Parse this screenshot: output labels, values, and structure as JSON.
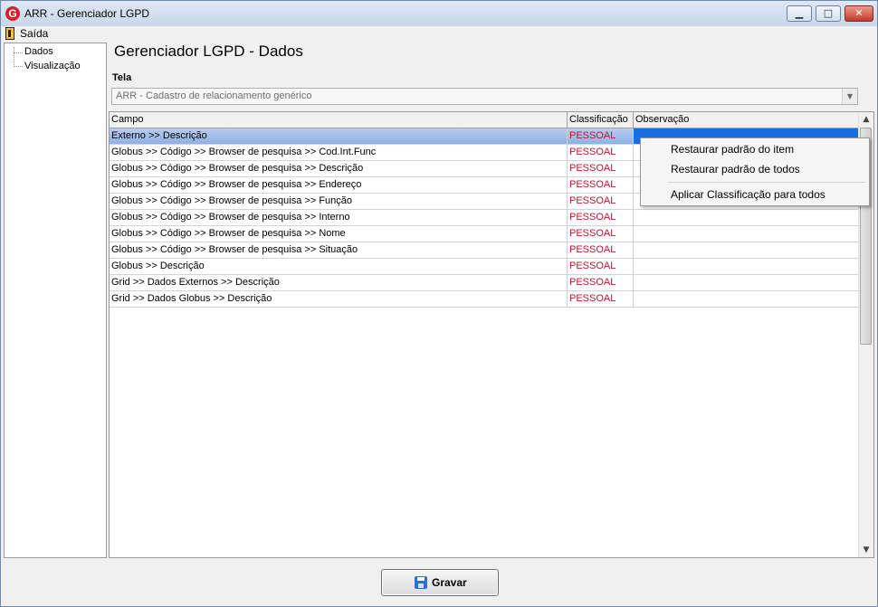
{
  "window": {
    "title": "ARR - Gerenciador LGPD",
    "app_icon_letter": "G",
    "controls": {
      "minimize": "▁",
      "maximize": "□",
      "close": "✕"
    }
  },
  "menu": {
    "items": [
      {
        "label": "Saída",
        "icon": "exit-door-icon"
      }
    ]
  },
  "sidebar": {
    "items": [
      {
        "label": "Dados"
      },
      {
        "label": "Visualização"
      }
    ]
  },
  "main": {
    "title": "Gerenciador LGPD - Dados",
    "tela_label": "Tela",
    "tela_value": "ARR - Cadastro de relacionamento genérico"
  },
  "grid": {
    "columns": [
      "Campo",
      "Classificação",
      "Observação"
    ],
    "rows": [
      {
        "campo": "Externo >> Descrição",
        "classificacao": "PESSOAL",
        "observacao": ""
      },
      {
        "campo": "Globus >> Código >> Browser de pesquisa >> Cod.Int.Func",
        "classificacao": "PESSOAL",
        "observacao": ""
      },
      {
        "campo": "Globus >> Código >> Browser de pesquisa >> Descrição",
        "classificacao": "PESSOAL",
        "observacao": ""
      },
      {
        "campo": "Globus >> Código >> Browser de pesquisa >> Endereço",
        "classificacao": "PESSOAL",
        "observacao": ""
      },
      {
        "campo": "Globus >> Código >> Browser de pesquisa >> Função",
        "classificacao": "PESSOAL",
        "observacao": ""
      },
      {
        "campo": "Globus >> Código >> Browser de pesquisa >> Interno",
        "classificacao": "PESSOAL",
        "observacao": ""
      },
      {
        "campo": "Globus >> Código >> Browser de pesquisa >> Nome",
        "classificacao": "PESSOAL",
        "observacao": ""
      },
      {
        "campo": "Globus >> Código >> Browser de pesquisa >> Situação",
        "classificacao": "PESSOAL",
        "observacao": ""
      },
      {
        "campo": "Globus >> Descrição",
        "classificacao": "PESSOAL",
        "observacao": ""
      },
      {
        "campo": "Grid >> Dados Externos >>  Descrição",
        "classificacao": "PESSOAL",
        "observacao": ""
      },
      {
        "campo": "Grid >> Dados Globus >> Descrição",
        "classificacao": "PESSOAL",
        "observacao": ""
      }
    ],
    "selected_row": 0,
    "classification_color": "#c8102e"
  },
  "context_menu": {
    "items": [
      "Restaurar padrão do item",
      "Restaurar padrão de todos",
      "Aplicar Classificação para todos"
    ]
  },
  "footer": {
    "save_label": "Gravar",
    "save_icon": "floppy-disk-icon"
  }
}
